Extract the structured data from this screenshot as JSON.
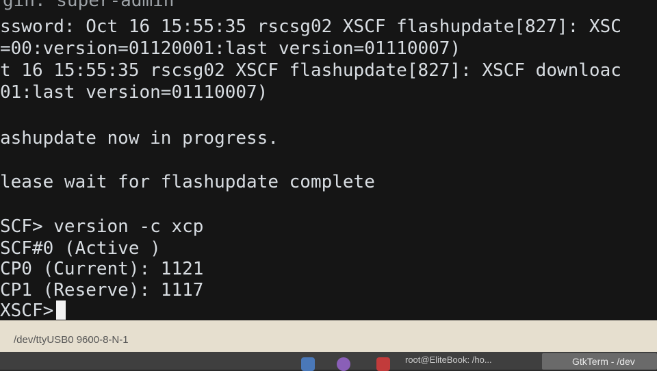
{
  "terminal": {
    "lines": [
      "gin: super-admin",
      "ssword: Oct 16 15:55:35 rscsg02 XSCF flashupdate[827]: XSC",
      "=00:version=01120001:last version=01110007)",
      "t 16 15:55:35 rscsg02 XSCF flashupdate[827]: XSCF downloac",
      "01:last version=01110007)",
      "",
      "ashupdate now in progress.",
      "",
      "lease wait for flashupdate complete",
      "",
      "SCF> version -c xcp",
      "SCF#0 (Active )",
      "CP0 (Current): 1121",
      "CP1 (Reserve): 1117",
      "XSCF>"
    ]
  },
  "statusbar": {
    "connection": "/dev/ttyUSB0  9600-8-N-1"
  },
  "taskbar": {
    "task_terminal": "root@EliteBook: /ho...",
    "task_gtkterm": "GtkTerm - /dev"
  }
}
